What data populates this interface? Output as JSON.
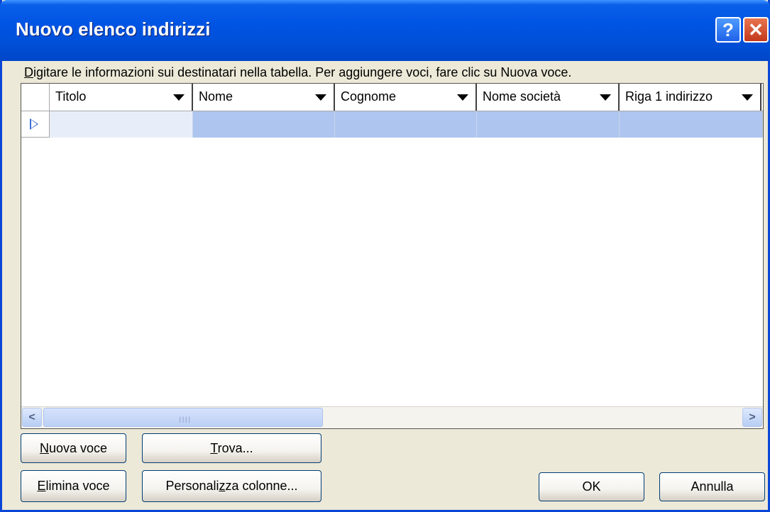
{
  "window": {
    "title": "Nuovo elenco indirizzi",
    "help_label": "?",
    "close_label": "✕"
  },
  "instructions": {
    "first_letter": "D",
    "rest": "igitare le informazioni sui destinatari nella tabella. Per aggiungere voci, fare clic su Nuova voce."
  },
  "table": {
    "columns": [
      {
        "label": "Titolo"
      },
      {
        "label": "Nome"
      },
      {
        "label": "Cognome"
      },
      {
        "label": "Nome società"
      },
      {
        "label": "Riga 1 indirizzo"
      }
    ],
    "rows": [
      [
        "",
        "",
        "",
        "",
        ""
      ]
    ],
    "scrollbar": {
      "left_arrow": "<",
      "right_arrow": ">",
      "grip": "IIII"
    }
  },
  "buttons": {
    "nuova_voce": {
      "accel": "N",
      "rest": "uova voce"
    },
    "trova": {
      "accel": "T",
      "rest": "rova..."
    },
    "elimina_voce": {
      "accel": "E",
      "rest": "limina voce"
    },
    "personalizza": {
      "before": "Personali",
      "accel": "z",
      "after": "za colonne..."
    },
    "ok": "OK",
    "annulla": "Annulla"
  },
  "colors": {
    "title_bar": "#0054e3",
    "selected_row": "#aec6ef",
    "dialog_bg": "#ece9d8"
  }
}
